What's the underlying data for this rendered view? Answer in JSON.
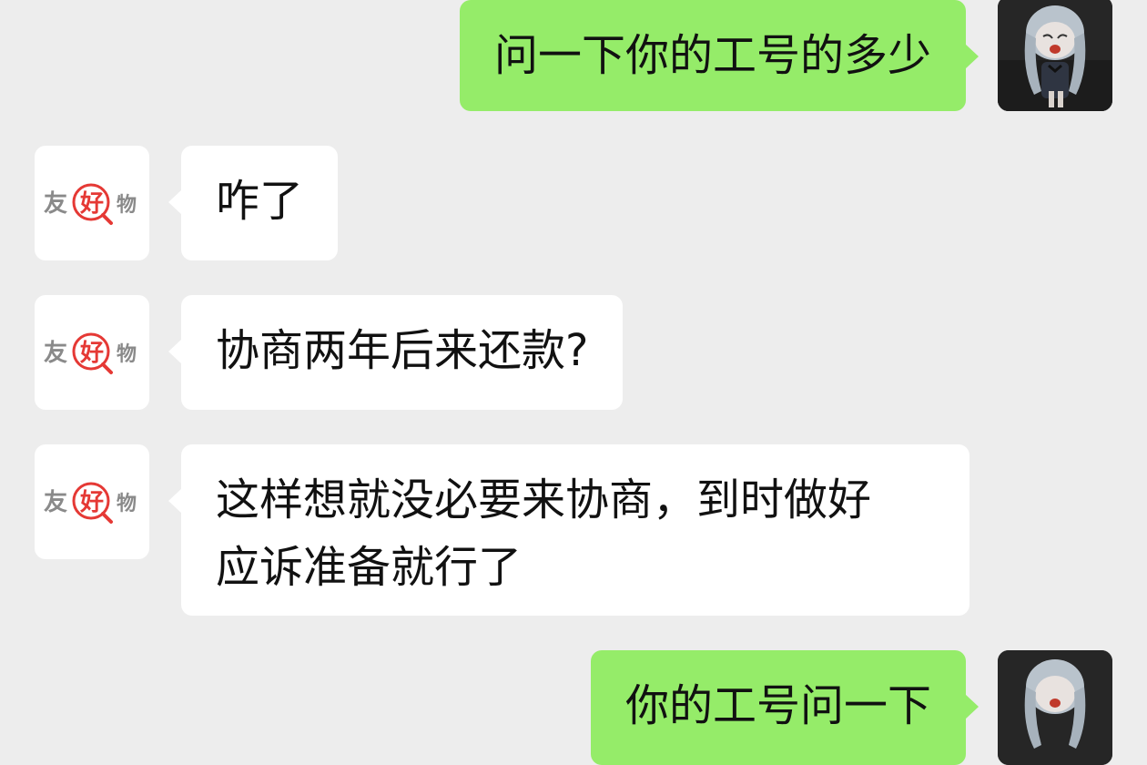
{
  "colors": {
    "background": "#ededed",
    "outgoing_bubble": "#95ec69",
    "incoming_bubble": "#ffffff",
    "brand_red": "#e53935",
    "brand_gray": "#8a8a8a"
  },
  "contact_avatar": {
    "icon": "brand-logo-icon",
    "text_left": "友",
    "text_center": "好",
    "text_right": "物"
  },
  "user_avatar": {
    "icon": "anime-character-avatar"
  },
  "messages": [
    {
      "direction": "outgoing",
      "lines": [
        "问一下你的工号的多少"
      ]
    },
    {
      "direction": "incoming",
      "lines": [
        "咋了"
      ]
    },
    {
      "direction": "incoming",
      "lines": [
        "协商两年后来还款?"
      ]
    },
    {
      "direction": "incoming",
      "lines": [
        "这样想就没必要来协商，到时做好",
        "应诉准备就行了"
      ]
    },
    {
      "direction": "outgoing",
      "lines": [
        "你的工号问一下"
      ]
    }
  ]
}
